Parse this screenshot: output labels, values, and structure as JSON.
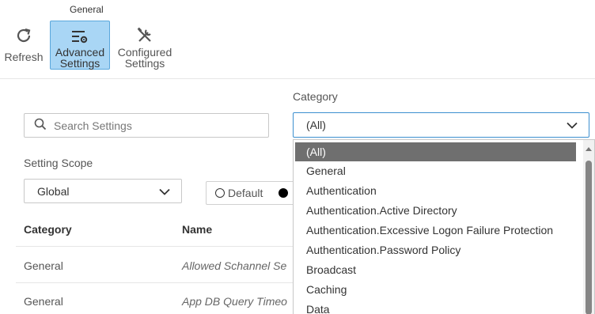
{
  "ribbon": {
    "group_label": "General",
    "refresh_label": "Refresh",
    "advanced_line1": "Advanced",
    "advanced_line2": "Settings",
    "configured_line1": "Configured",
    "configured_line2": "Settings"
  },
  "search": {
    "placeholder": "Search Settings",
    "value": ""
  },
  "category": {
    "label": "Category",
    "selected": "(All)"
  },
  "scope": {
    "label": "Setting Scope",
    "selected": "Global",
    "radio_default": "Default"
  },
  "grid": {
    "columns": [
      "Category",
      "Name"
    ],
    "rows": [
      {
        "category": "General",
        "name": "Allowed Schannel Se"
      },
      {
        "category": "General",
        "name": "App DB Query Timeo"
      }
    ]
  },
  "dropdown": {
    "options": [
      "(All)",
      "General",
      "Authentication",
      "Authentication.Active Directory",
      "Authentication.Excessive Logon Failure Protection",
      "Authentication.Password Policy",
      "Broadcast",
      "Caching",
      "Data"
    ],
    "selected_index": 0
  },
  "icons": {
    "refresh": "refresh-icon",
    "advanced": "sliders-gear-icon",
    "configured": "tools-icon",
    "search": "search-icon",
    "chevron": "chevron-down-icon"
  },
  "colors": {
    "accent_selected": "#a9d6f5",
    "accent_border": "#5aa7dc",
    "focus_border": "#3c8fcf",
    "option_highlight": "#6f6f6f"
  }
}
